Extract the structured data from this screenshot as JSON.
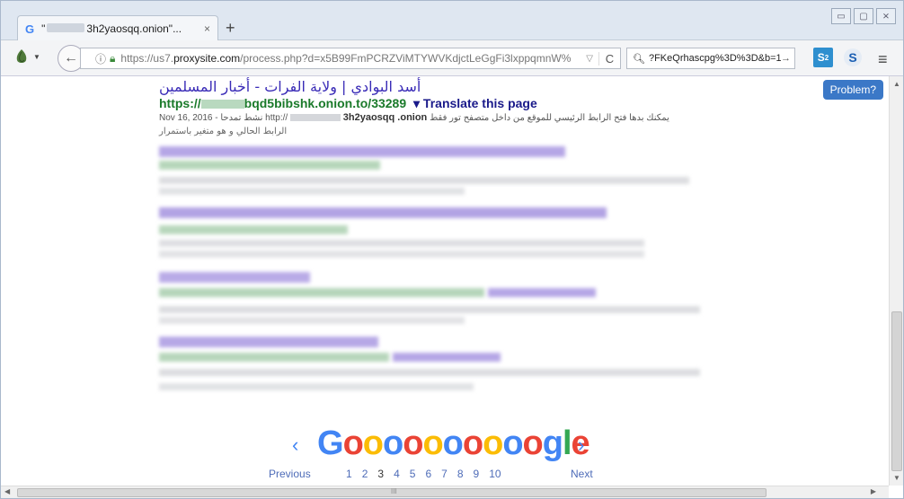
{
  "tab": {
    "favicon": "G",
    "title_prefix": "\"",
    "title_suffix": "3h2yaosqq.onion\"...",
    "close": "×"
  },
  "newtab": "+",
  "window_buttons": [
    "▭",
    "▢",
    "⨯"
  ],
  "url": {
    "prefix": "https://us7.",
    "domain": "proxysite.com",
    "path": "/process.php?d=x5B99FmPCRZViMTYWVKdjctLeGgFi3lxppqmnW%",
    "dropdown": "▽",
    "reload": "C"
  },
  "search": {
    "text": "?FKeQrhascpg%3D%3D&b=1",
    "go": "→"
  },
  "toolbar": {
    "s2_label": "S",
    "s2_badge": "2",
    "s_label": "S",
    "menu": "≡"
  },
  "problem_button": "Problem?",
  "result": {
    "title": "أسد البوادي | ولاية الفرات - أخبار المسلمين",
    "url_prefix": "https://",
    "url_suffix": "bqd5bibshk.onion.to/33289",
    "translate": "▾ Translate this page",
    "date": "Nov 16, 2016 - نشط تمدحا http://",
    "onion_bold": "3h2yaosqq .onion",
    "snippet_ar": "يمكنك بدها فتح الرابط الرئيسي للموقع من داخل متصفح تور فقط",
    "snippet_ar2": "الرابط الحالي و هو متغير باستمرار"
  },
  "pagination": {
    "prev_arrow": "‹",
    "next_arrow": "›",
    "logo_letters": [
      {
        "ch": "G",
        "c": "b"
      },
      {
        "ch": "o",
        "c": "r"
      },
      {
        "ch": "o",
        "c": "y"
      },
      {
        "ch": "o",
        "c": "b"
      },
      {
        "ch": "o",
        "c": "r"
      },
      {
        "ch": "o",
        "c": "y"
      },
      {
        "ch": "o",
        "c": "b"
      },
      {
        "ch": "o",
        "c": "r"
      },
      {
        "ch": "o",
        "c": "y"
      },
      {
        "ch": "o",
        "c": "b"
      },
      {
        "ch": "o",
        "c": "r"
      },
      {
        "ch": "g",
        "c": "b"
      },
      {
        "ch": "l",
        "c": "g"
      },
      {
        "ch": "e",
        "c": "r"
      }
    ],
    "previous": "Previous",
    "next": "Next",
    "pages": [
      "1",
      "2",
      "3",
      "4",
      "5",
      "6",
      "7",
      "8",
      "9",
      "10"
    ],
    "current_page": "3"
  },
  "scroll": {
    "up": "▲",
    "down": "▼",
    "left": "◀",
    "right": "▶",
    "grip": "III"
  },
  "colors": {
    "title": "#3a2cb7",
    "url_green": "#1a7a2a",
    "link_blue": "#4e6cb8",
    "problem_blue": "#3b78c7"
  }
}
